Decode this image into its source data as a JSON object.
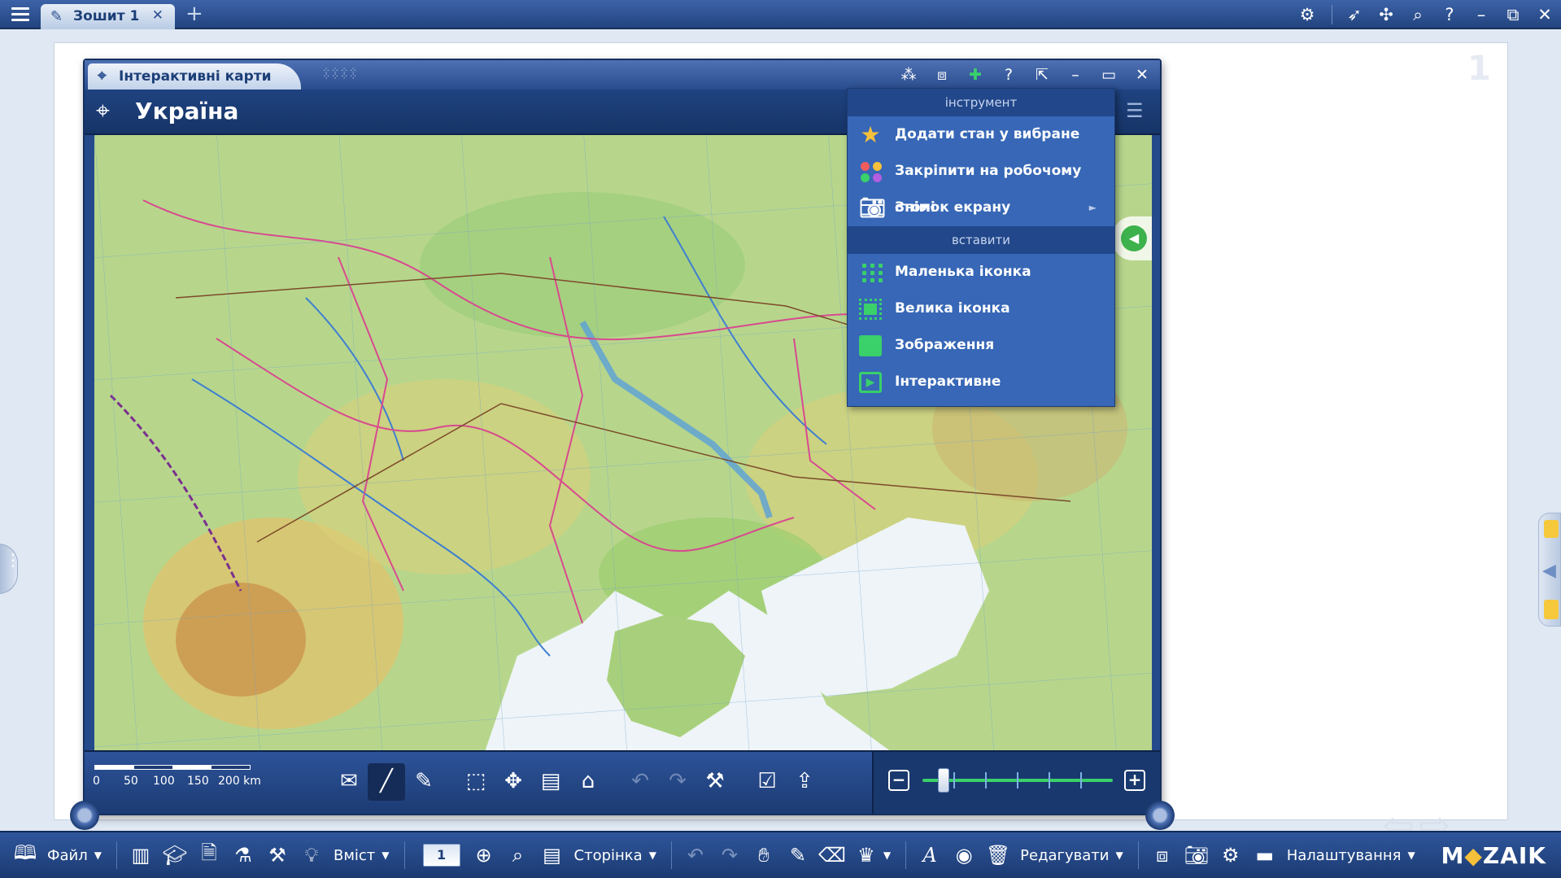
{
  "topbar": {
    "tab_title": "Зошит 1",
    "icons": [
      "settings-gear-icon",
      "rocket-icon",
      "apps-icon",
      "search-icon",
      "help-icon",
      "minimize-icon",
      "restore-icon",
      "close-icon"
    ]
  },
  "page": {
    "number": "1"
  },
  "window": {
    "title": "Інтерактивні карти",
    "map_title": "Україна",
    "controls": [
      "share-icon",
      "layers-icon",
      "pin-icon",
      "help-icon",
      "external-icon",
      "minimize-icon",
      "maximize-icon",
      "close-icon"
    ]
  },
  "context_menu": {
    "section_tool": "інструмент",
    "section_insert": "вставити",
    "items": {
      "add_favorite": "Додати стан у вибране",
      "pin_desktop": "Закріпити на робочому столі",
      "screenshot": "Знімок екрану",
      "small_icon": "Маленька іконка",
      "big_icon": "Велика іконка",
      "image": "Зображення",
      "interactive": "Інтерактивне"
    },
    "submenu_arrow": "►"
  },
  "map_toolbar": {
    "scale_labels": [
      "0",
      "50",
      "100",
      "150",
      "200 km"
    ],
    "zoom_minus": "−",
    "zoom_plus": "+",
    "zoom_level": 0.11
  },
  "bottombar": {
    "file_label": "Файл",
    "content_label": "Вміст",
    "page_value": "1",
    "page_label": "Сторінка",
    "edit_label": "Редагувати",
    "settings_label": "Налаштування",
    "logo_left": "M",
    "logo_mid": "◆",
    "logo_right": "ZAIK"
  },
  "colors": {
    "accent": "#2a4d8e",
    "menu_bg": "#3767b6",
    "green": "#3ad06a",
    "land": "#b7d68c",
    "sea": "#eef4f8"
  }
}
